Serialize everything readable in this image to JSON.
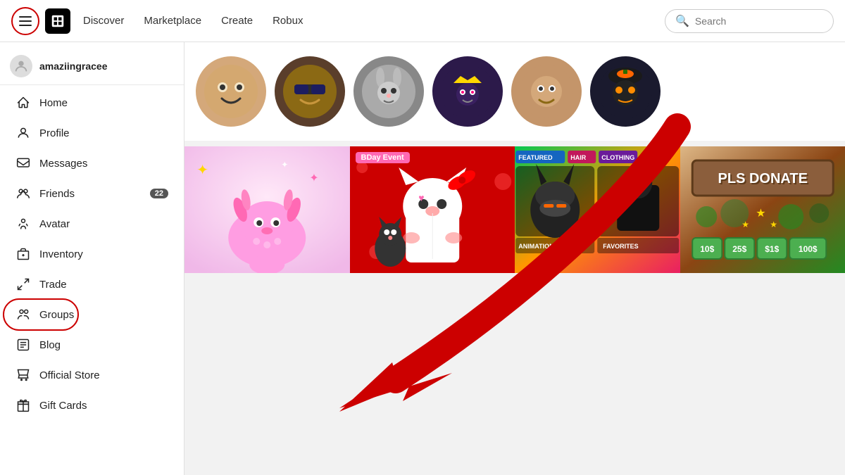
{
  "topNav": {
    "links": [
      {
        "label": "Discover",
        "name": "discover"
      },
      {
        "label": "Marketplace",
        "name": "marketplace"
      },
      {
        "label": "Create",
        "name": "create"
      },
      {
        "label": "Robux",
        "name": "robux"
      }
    ],
    "search": {
      "placeholder": "Search"
    }
  },
  "sidebar": {
    "username": "amaziingracee",
    "items": [
      {
        "label": "Home",
        "icon": "home",
        "badge": null
      },
      {
        "label": "Profile",
        "icon": "user",
        "badge": null
      },
      {
        "label": "Messages",
        "icon": "message",
        "badge": null
      },
      {
        "label": "Friends",
        "icon": "friends",
        "badge": "22"
      },
      {
        "label": "Avatar",
        "icon": "avatar",
        "badge": null
      },
      {
        "label": "Inventory",
        "icon": "inventory",
        "badge": null
      },
      {
        "label": "Trade",
        "icon": "trade",
        "badge": null
      },
      {
        "label": "Groups",
        "icon": "groups",
        "badge": null
      },
      {
        "label": "Blog",
        "icon": "blog",
        "badge": null
      },
      {
        "label": "Official Store",
        "icon": "store",
        "badge": null
      },
      {
        "label": "Gift Cards",
        "icon": "gift",
        "badge": null
      }
    ]
  },
  "gameTiles": [
    {
      "label": "",
      "name": "axolotl-game"
    },
    {
      "label": "BDay Event",
      "name": "bday-game"
    },
    {
      "label": "FEATURED",
      "name": "featured-game"
    },
    {
      "label": "PLS DONATE",
      "name": "pls-donate-game"
    }
  ],
  "donateAmounts": [
    "10$",
    "25$",
    "$1$",
    "100$"
  ]
}
